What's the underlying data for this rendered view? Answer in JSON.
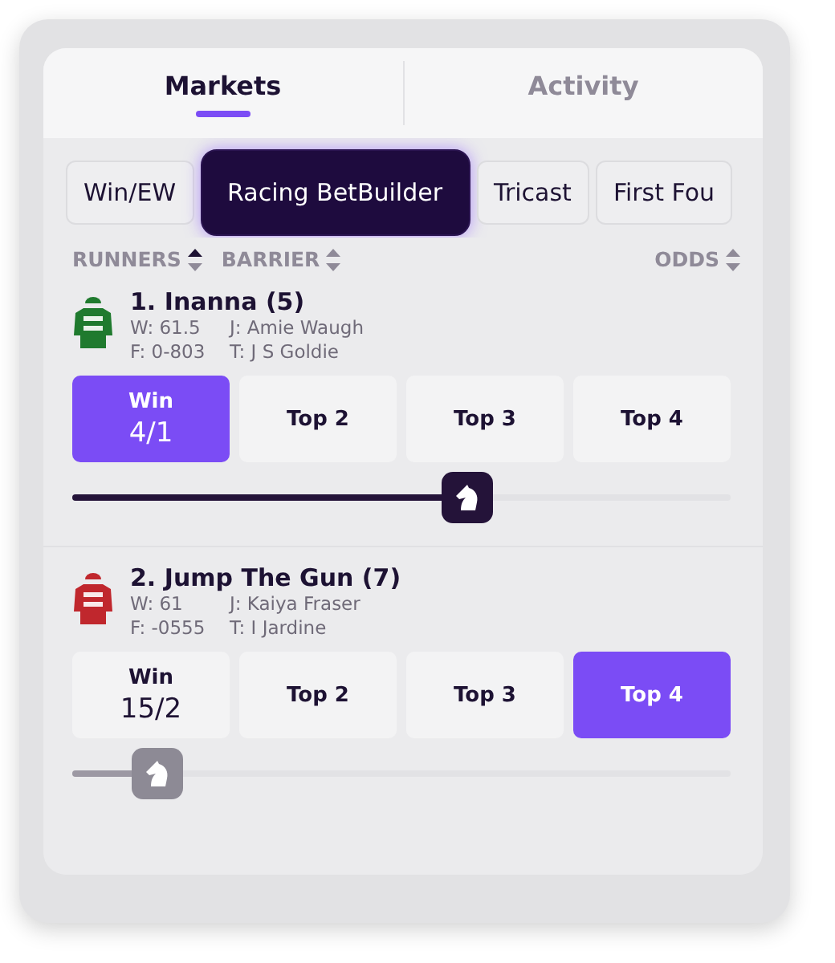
{
  "tabs": [
    {
      "label": "Markets",
      "selected": true
    },
    {
      "label": "Activity",
      "selected": false
    }
  ],
  "markets": [
    {
      "label": "Win/EW",
      "selected": false
    },
    {
      "label": "Racing BetBuilder",
      "selected": true
    },
    {
      "label": "Tricast",
      "selected": false
    },
    {
      "label": "First Fou",
      "selected": false
    }
  ],
  "columns": [
    {
      "label": "RUNNERS",
      "sorted": true
    },
    {
      "label": "BARRIER",
      "sorted": false
    },
    {
      "label": "ODDS",
      "sorted": false
    }
  ],
  "runners": [
    {
      "name": "1. Inanna (5)",
      "color": "#1f7a2e",
      "weight": "W: 61.5",
      "form": "F: 0-803",
      "jockey": "J: Amie Waugh",
      "trainer": "T: J S Goldie",
      "options": [
        {
          "label": "Win",
          "odds": "4/1",
          "selected": true
        },
        {
          "label": "Top 2",
          "selected": false
        },
        {
          "label": "Top 3",
          "selected": false
        },
        {
          "label": "Top 4",
          "selected": false
        }
      ],
      "slider": {
        "level": 0.6,
        "active": true
      }
    },
    {
      "name": "2. Jump The Gun (7)",
      "color": "#c0272d",
      "weight": "W: 61",
      "form": "F: -0555",
      "jockey": "J: Kaiya Fraser",
      "trainer": "T: I Jardine",
      "options": [
        {
          "label": "Win",
          "odds": "15/2",
          "selected": false
        },
        {
          "label": "Top 2",
          "selected": false
        },
        {
          "label": "Top 3",
          "selected": false
        },
        {
          "label": "Top 4",
          "selected": true
        }
      ],
      "slider": {
        "level": 0.13,
        "active": false
      }
    }
  ]
}
